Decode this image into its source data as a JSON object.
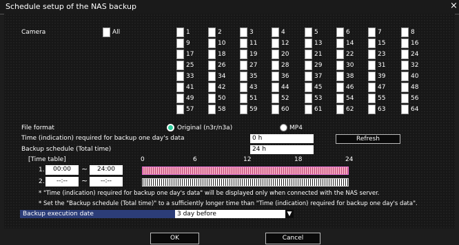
{
  "window": {
    "title": "Schedule setup of the NAS backup",
    "close_glyph": "×"
  },
  "camera": {
    "label": "Camera",
    "all_label": "All",
    "numbers": [
      "1",
      "2",
      "3",
      "4",
      "5",
      "6",
      "7",
      "8",
      "9",
      "10",
      "11",
      "12",
      "13",
      "14",
      "15",
      "16",
      "17",
      "18",
      "19",
      "20",
      "21",
      "22",
      "23",
      "24",
      "25",
      "26",
      "27",
      "28",
      "29",
      "30",
      "31",
      "32",
      "33",
      "34",
      "35",
      "36",
      "37",
      "38",
      "39",
      "40",
      "41",
      "42",
      "43",
      "44",
      "45",
      "46",
      "47",
      "48",
      "49",
      "50",
      "51",
      "52",
      "53",
      "54",
      "55",
      "56",
      "57",
      "58",
      "59",
      "60",
      "61",
      "62",
      "63",
      "64"
    ]
  },
  "file_format": {
    "label": "File format",
    "options": [
      {
        "label": "Original (n3r/n3a)",
        "selected": true
      },
      {
        "label": "MP4",
        "selected": false
      }
    ]
  },
  "time_required": {
    "label": "Time (indication) required for backup one day's data",
    "value": "0 h"
  },
  "backup_schedule": {
    "label": "Backup schedule (Total time)",
    "value": "24 h"
  },
  "refresh_label": "Refresh",
  "timetable": {
    "label": "[Time table]",
    "ticks": [
      "0",
      "6",
      "12",
      "18",
      "24"
    ],
    "tilde": "~",
    "rows": [
      {
        "num": "1.",
        "start": "00:00",
        "end": "24:00",
        "active": true
      },
      {
        "num": "2.",
        "start": "--:--",
        "end": "--:--",
        "active": false
      }
    ]
  },
  "notes": [
    "* \"Time (indication) required for backup one day's data\" will be displayed only when connected with the NAS server.",
    "* Set the \"Backup schedule (Total time)\" to a sufficiently longer time than \"Time (indication) required for backup one day's data\"."
  ],
  "execution_date": {
    "label": "Backup execution date",
    "value": "3 day before"
  },
  "buttons": {
    "ok": "OK",
    "cancel": "Cancel"
  },
  "colors": {
    "accent_blue": "#2c3d78",
    "schedule_bar": "#f2a8c0",
    "radio_on": "#2ecc9a"
  }
}
